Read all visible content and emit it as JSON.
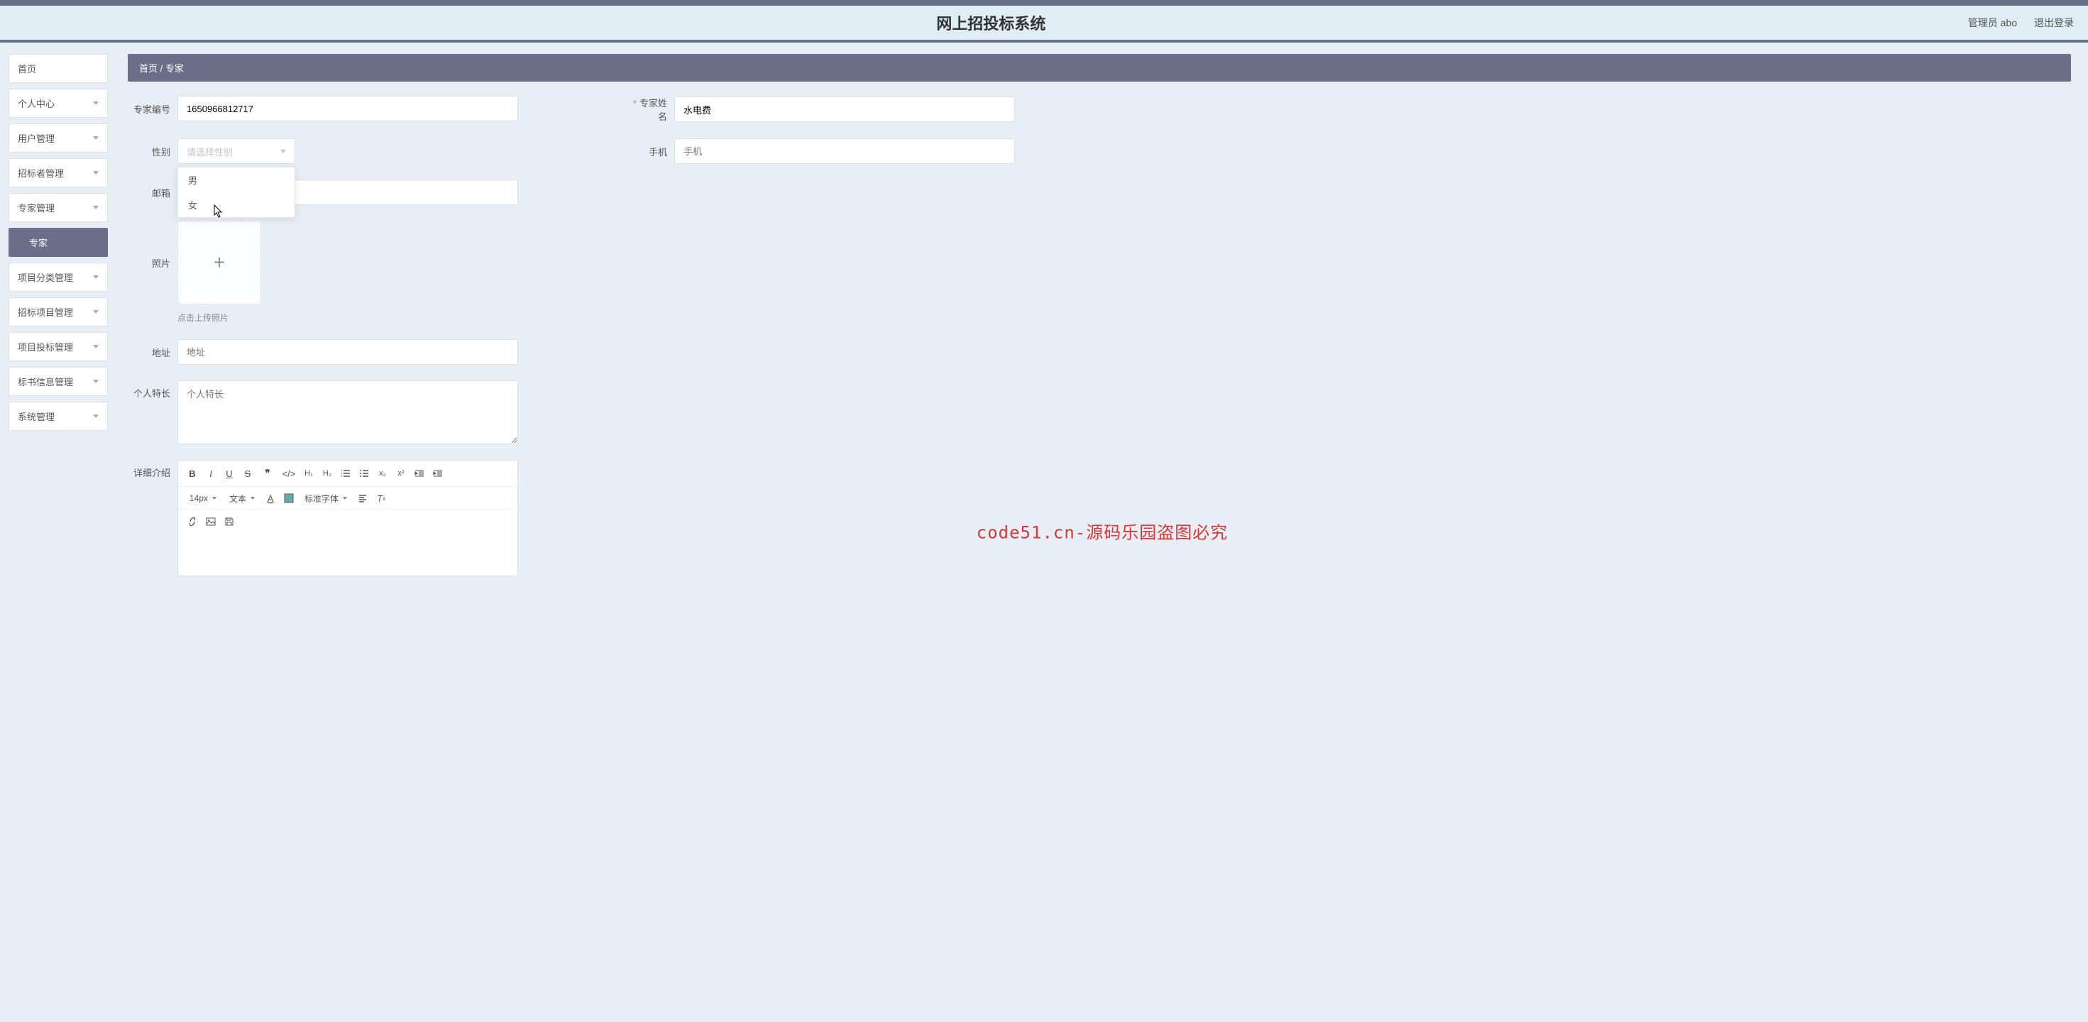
{
  "header": {
    "title": "网上招投标系统",
    "user_label": "管理员 abo",
    "logout_label": "退出登录"
  },
  "sidebar": {
    "items": [
      {
        "label": "首页",
        "expandable": false
      },
      {
        "label": "个人中心",
        "expandable": true
      },
      {
        "label": "用户管理",
        "expandable": true
      },
      {
        "label": "招标者管理",
        "expandable": true
      },
      {
        "label": "专家管理",
        "expandable": true
      },
      {
        "label": "专家",
        "expandable": false,
        "active": true
      },
      {
        "label": "项目分类管理",
        "expandable": true
      },
      {
        "label": "招标项目管理",
        "expandable": true
      },
      {
        "label": "项目投标管理",
        "expandable": true
      },
      {
        "label": "标书信息管理",
        "expandable": true
      },
      {
        "label": "系统管理",
        "expandable": true
      }
    ]
  },
  "breadcrumb": {
    "home": "首页",
    "sep": "/",
    "current": "专家"
  },
  "form": {
    "expert_no_label": "专家编号",
    "expert_no_value": "1650966812717",
    "expert_name_label": "专家姓名",
    "expert_name_value": "水电费",
    "gender_label": "性别",
    "gender_placeholder": "请选择性别",
    "gender_options": [
      "男",
      "女"
    ],
    "phone_label": "手机",
    "phone_placeholder": "手机",
    "email_label": "邮箱",
    "photo_label": "照片",
    "upload_hint": "点击上传照片",
    "address_label": "地址",
    "address_placeholder": "地址",
    "specialty_label": "个人特长",
    "specialty_placeholder": "个人特长",
    "detail_label": "详细介绍"
  },
  "editor": {
    "font_size": "14px",
    "block_type": "文本",
    "font_family": "标准字体"
  },
  "watermark": {
    "repeat": "code51.cn",
    "center": "code51.cn-源码乐园盗图必究"
  }
}
